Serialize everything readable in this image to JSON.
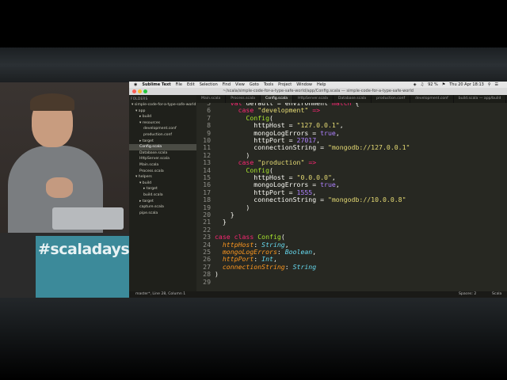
{
  "banner": {
    "hashtag": "#scaladays"
  },
  "menubar": {
    "app": "Sublime Text",
    "items": [
      "File",
      "Edit",
      "Selection",
      "Find",
      "View",
      "Goto",
      "Tools",
      "Project",
      "Window",
      "Help"
    ],
    "battery": "92 %",
    "datetime": "Thu 20 Apr 18:13"
  },
  "window": {
    "title": "~/scala/simple-code-for-a-type-safe-world/app/Config.scala — simple-code-for-a-type-safe-world"
  },
  "sidebar": {
    "header": "FOLDERS",
    "items": [
      {
        "label": "simple-code-for-a-type-safe-world",
        "depth": 0,
        "arrow": "▾"
      },
      {
        "label": "app",
        "depth": 1,
        "arrow": "▾"
      },
      {
        "label": "build",
        "depth": 2,
        "arrow": "▸"
      },
      {
        "label": "resources",
        "depth": 2,
        "arrow": "▾"
      },
      {
        "label": "development.conf",
        "depth": 3,
        "arrow": ""
      },
      {
        "label": "production.conf",
        "depth": 3,
        "arrow": ""
      },
      {
        "label": "target",
        "depth": 2,
        "arrow": "▸"
      },
      {
        "label": "Config.scala",
        "depth": 2,
        "arrow": "",
        "active": true
      },
      {
        "label": "Database.scala",
        "depth": 2,
        "arrow": ""
      },
      {
        "label": "HttpServer.scala",
        "depth": 2,
        "arrow": ""
      },
      {
        "label": "Main.scala",
        "depth": 2,
        "arrow": ""
      },
      {
        "label": "Process.scala",
        "depth": 2,
        "arrow": ""
      },
      {
        "label": "helpers",
        "depth": 1,
        "arrow": "▾"
      },
      {
        "label": "build",
        "depth": 2,
        "arrow": "▾"
      },
      {
        "label": "target",
        "depth": 3,
        "arrow": "▸"
      },
      {
        "label": "build.scala",
        "depth": 3,
        "arrow": ""
      },
      {
        "label": "target",
        "depth": 2,
        "arrow": "▸"
      },
      {
        "label": "capture.scala",
        "depth": 2,
        "arrow": ""
      },
      {
        "label": "pipe.scala",
        "depth": 2,
        "arrow": ""
      }
    ]
  },
  "tabs": [
    {
      "label": "Main.scala",
      "active": false
    },
    {
      "label": "Process.scala",
      "active": false
    },
    {
      "label": "Config.scala",
      "active": true
    },
    {
      "label": "HttpServer.scala",
      "active": false
    },
    {
      "label": "Database.scala",
      "active": false
    },
    {
      "label": "production.conf",
      "active": false
    },
    {
      "label": "development.conf",
      "active": false
    },
    {
      "label": "build.scala — app/build",
      "active": false
    },
    {
      "label": "Item/build",
      "active": false
    }
  ],
  "code": [
    {
      "n": "5",
      "t": [
        [
          "    ",
          "pl"
        ],
        [
          "val",
          "kw"
        ],
        [
          " default = ",
          "pl"
        ],
        [
          "environment",
          "pl"
        ],
        [
          " match",
          "kw"
        ],
        [
          " {",
          "pl"
        ]
      ]
    },
    {
      "n": "6",
      "t": [
        [
          "      ",
          "pl"
        ],
        [
          "case",
          "kw"
        ],
        [
          " ",
          "pl"
        ],
        [
          "\"development\"",
          "st"
        ],
        [
          " =>",
          "kw"
        ]
      ]
    },
    {
      "n": "7",
      "t": [
        [
          "        ",
          "pl"
        ],
        [
          "Config",
          "cl"
        ],
        [
          "(",
          "pl"
        ]
      ]
    },
    {
      "n": "8",
      "t": [
        [
          "          httpHost = ",
          "pl"
        ],
        [
          "\"127.0.0.1\"",
          "st"
        ],
        [
          ",",
          "pl"
        ]
      ]
    },
    {
      "n": "9",
      "t": [
        [
          "          mongoLogErrors = ",
          "pl"
        ],
        [
          "true",
          "nu"
        ],
        [
          ",",
          "pl"
        ]
      ]
    },
    {
      "n": "10",
      "t": [
        [
          "          httpPort = ",
          "pl"
        ],
        [
          "27017",
          "nu"
        ],
        [
          ",",
          "pl"
        ]
      ]
    },
    {
      "n": "11",
      "t": [
        [
          "          connectionString = ",
          "pl"
        ],
        [
          "\"mongodb://127.0.0.1\"",
          "st"
        ]
      ]
    },
    {
      "n": "12",
      "t": [
        [
          "        )",
          "pl"
        ]
      ]
    },
    {
      "n": "13",
      "t": [
        [
          "      ",
          "pl"
        ],
        [
          "case",
          "kw"
        ],
        [
          " ",
          "pl"
        ],
        [
          "\"production\"",
          "st"
        ],
        [
          " =>",
          "kw"
        ]
      ]
    },
    {
      "n": "14",
      "t": [
        [
          "        ",
          "pl"
        ],
        [
          "Config",
          "cl"
        ],
        [
          "(",
          "pl"
        ]
      ]
    },
    {
      "n": "15",
      "t": [
        [
          "          httpHost = ",
          "pl"
        ],
        [
          "\"0.0.0.0\"",
          "st"
        ],
        [
          ",",
          "pl"
        ]
      ]
    },
    {
      "n": "16",
      "t": [
        [
          "          mongoLogErrors = ",
          "pl"
        ],
        [
          "true",
          "nu"
        ],
        [
          ",",
          "pl"
        ]
      ]
    },
    {
      "n": "17",
      "t": [
        [
          "          httpPort = ",
          "pl"
        ],
        [
          "1555",
          "nu"
        ],
        [
          ",",
          "pl"
        ]
      ]
    },
    {
      "n": "18",
      "t": [
        [
          "          connectionString = ",
          "pl"
        ],
        [
          "\"mongodb://10.0.0.8\"",
          "st"
        ]
      ]
    },
    {
      "n": "19",
      "t": [
        [
          "        )",
          "pl"
        ]
      ]
    },
    {
      "n": "20",
      "t": [
        [
          "    }",
          "pl"
        ]
      ]
    },
    {
      "n": "21",
      "t": [
        [
          "  }",
          "pl"
        ]
      ]
    },
    {
      "n": "22",
      "t": [
        [
          "",
          "pl"
        ]
      ]
    },
    {
      "n": "23",
      "t": [
        [
          "case class",
          "kw"
        ],
        [
          " ",
          "pl"
        ],
        [
          "Config",
          "cl"
        ],
        [
          "(",
          "pl"
        ]
      ]
    },
    {
      "n": "24",
      "t": [
        [
          "  ",
          "pl"
        ],
        [
          "httpHost",
          "it"
        ],
        [
          ": ",
          "pl"
        ],
        [
          "String",
          "ty"
        ],
        [
          ",",
          "pl"
        ]
      ]
    },
    {
      "n": "25",
      "t": [
        [
          "  ",
          "pl"
        ],
        [
          "mongoLogErrors",
          "it"
        ],
        [
          ": ",
          "pl"
        ],
        [
          "Boolean",
          "ty"
        ],
        [
          ",",
          "pl"
        ]
      ]
    },
    {
      "n": "26",
      "t": [
        [
          "  ",
          "pl"
        ],
        [
          "httpPort",
          "it"
        ],
        [
          ": ",
          "pl"
        ],
        [
          "Int",
          "ty"
        ],
        [
          ",",
          "pl"
        ]
      ]
    },
    {
      "n": "27",
      "t": [
        [
          "  ",
          "pl"
        ],
        [
          "connectionString",
          "it"
        ],
        [
          ": ",
          "pl"
        ],
        [
          "String",
          "ty"
        ]
      ]
    },
    {
      "n": "28",
      "t": [
        [
          ")",
          "pl"
        ]
      ]
    },
    {
      "n": "29",
      "t": [
        [
          "",
          "pl"
        ]
      ]
    }
  ],
  "status": {
    "left": "master*, Line 28, Column 1",
    "spaces": "Spaces: 2",
    "syntax": "Scala"
  },
  "colors": {
    "editor_bg": "#272822",
    "keyword": "#f92672",
    "string": "#e6db74",
    "number": "#ae81ff",
    "class": "#a6e22e",
    "type": "#66d9ef",
    "param": "#fd971f"
  }
}
